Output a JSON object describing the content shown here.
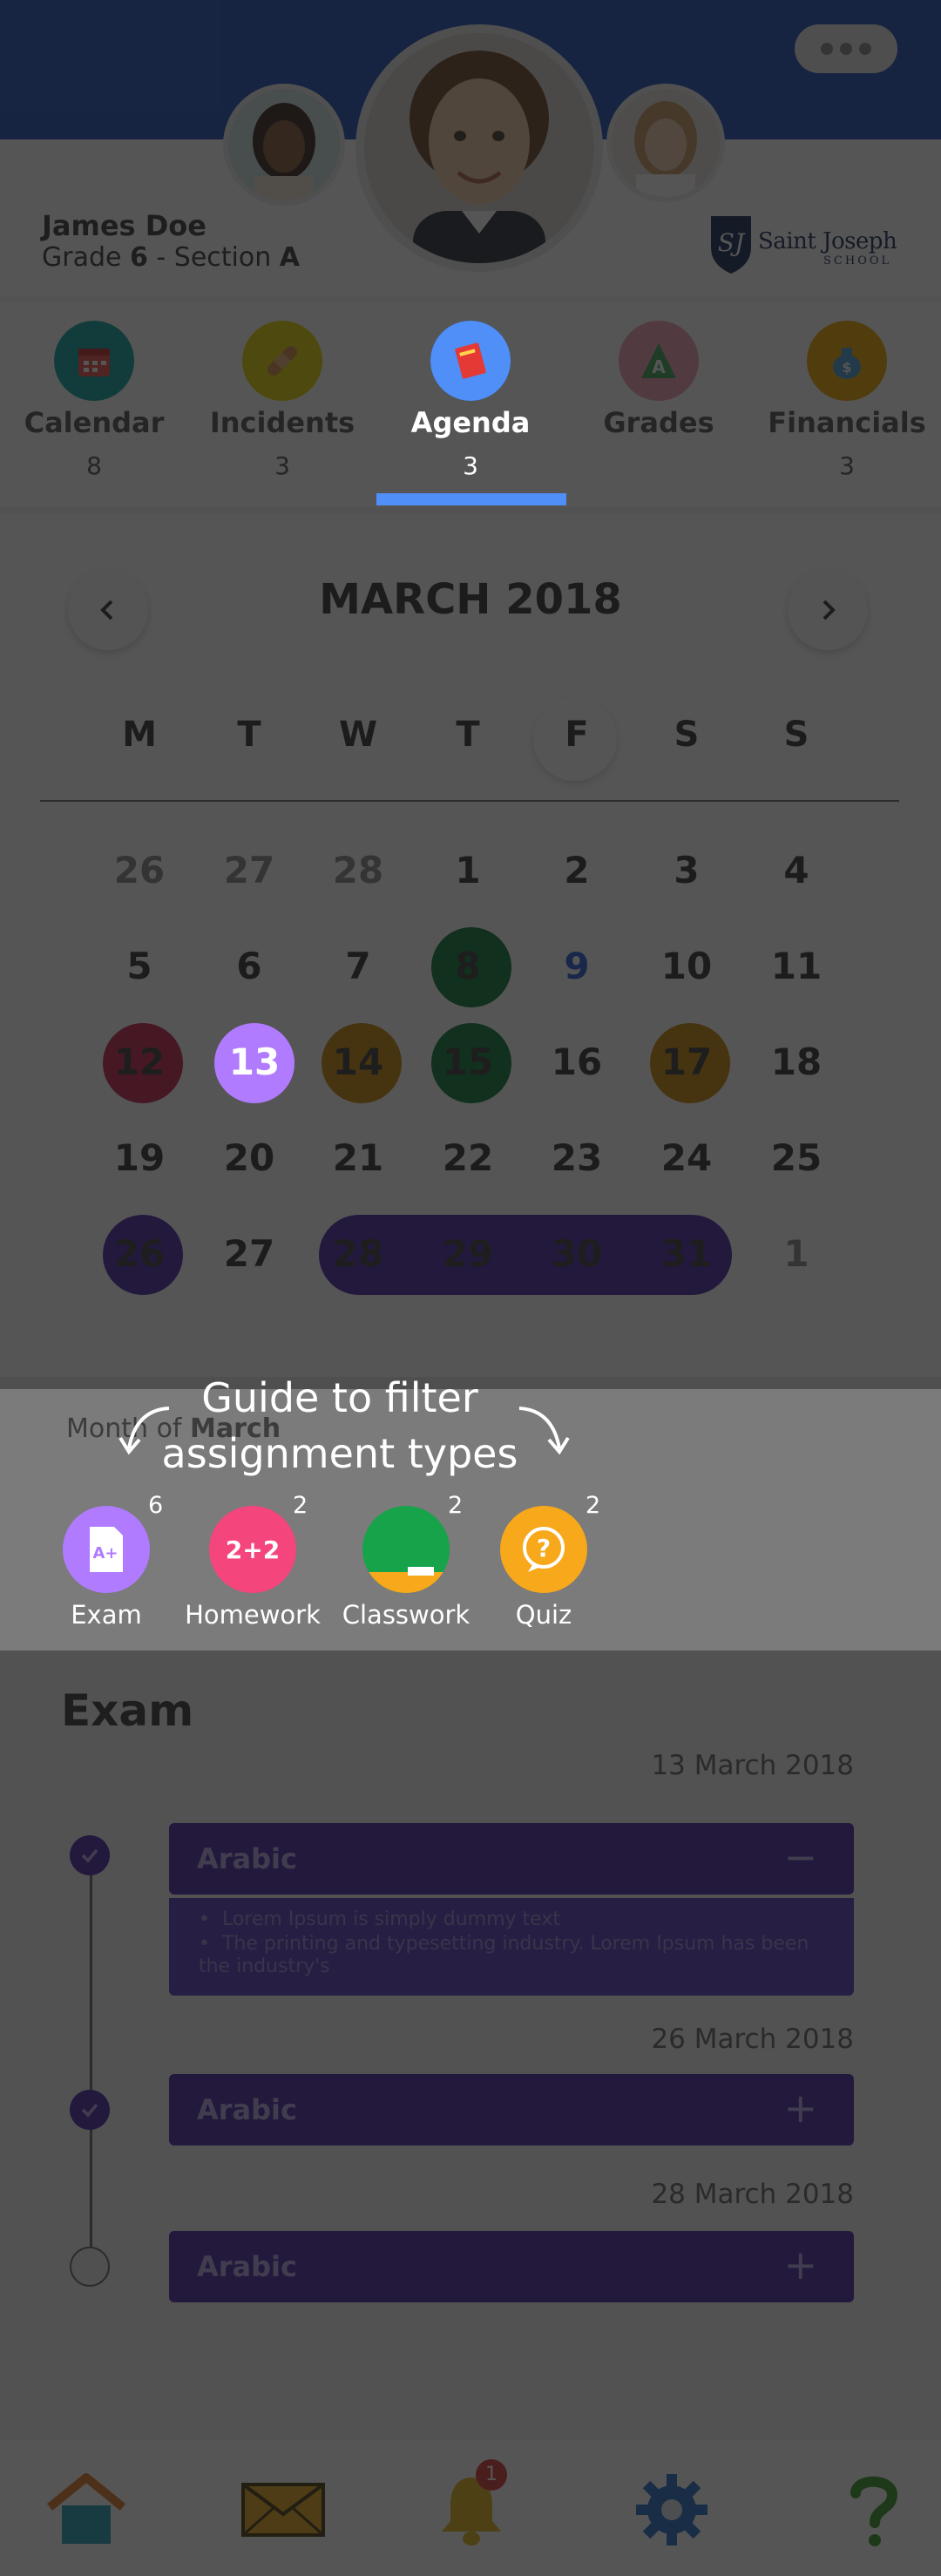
{
  "header": {
    "more_menu": "more-options",
    "student_name": "James Doe",
    "grade_prefix": "Grade ",
    "grade_num": "6",
    "section_prefix": " - Section ",
    "section_letter": "A",
    "school_name": "Saint Joseph",
    "school_sub": "SCHOOL"
  },
  "tabs": [
    {
      "label": "Calendar",
      "count": "8",
      "icon": "calendar-icon",
      "color": "#11a7a0"
    },
    {
      "label": "Incidents",
      "count": "3",
      "icon": "bandage-icon",
      "color": "#e5d400"
    },
    {
      "label": "Agenda",
      "count": "3",
      "icon": "book-icon",
      "color": "#4f8ff7",
      "active": true
    },
    {
      "label": "Grades",
      "count": "",
      "icon": "grade-a-icon",
      "color": "#f2a0b5"
    },
    {
      "label": "Financials",
      "count": "3",
      "icon": "money-bag-icon",
      "color": "#f0a500"
    }
  ],
  "calendar": {
    "month_title": "MARCH 2018",
    "weekdays": [
      "M",
      "T",
      "W",
      "T",
      "F",
      "S",
      "S"
    ],
    "week1": [
      "26",
      "27",
      "28",
      "1",
      "2",
      "3",
      "4"
    ],
    "week2": [
      "5",
      "6",
      "7",
      "8",
      "9",
      "10",
      "11"
    ],
    "week3": [
      "12",
      "13",
      "14",
      "15",
      "16",
      "17",
      "18"
    ],
    "week4": [
      "19",
      "20",
      "21",
      "22",
      "23",
      "24",
      "25"
    ],
    "week5": [
      "26",
      "27",
      "28",
      "29",
      "30",
      "31",
      "1"
    ]
  },
  "legend": {
    "month_prefix": "Month of ",
    "month_name": "March",
    "guide_line1": "Guide to filter",
    "guide_line2": "assignment types",
    "items": [
      {
        "label": "Exam",
        "count": "6",
        "color": "#b07bff"
      },
      {
        "label": "Homework",
        "count": "2",
        "color": "#f4457d"
      },
      {
        "label": "Classwork",
        "count": "2",
        "color": "#17a34a"
      },
      {
        "label": "Quiz",
        "count": "2",
        "color": "#f7a81b"
      }
    ]
  },
  "exam": {
    "heading": "Exam",
    "entries": [
      {
        "date": "13 March 2018",
        "subject": "Arabic",
        "toggle": "−",
        "expanded": true,
        "bullets": [
          "Lorem Ipsum is simply dummy text",
          "The printing and typesetting industry. Lorem Ipsum has been the industry's"
        ]
      },
      {
        "date": "26 March 2018",
        "subject": "Arabic",
        "toggle": "+"
      },
      {
        "date": "28 March 2018",
        "subject": "Arabic",
        "toggle": "+"
      }
    ]
  },
  "bottom_nav": {
    "items": [
      "home-icon",
      "mail-icon",
      "bell-icon",
      "settings-icon",
      "help-icon"
    ],
    "notification_count": "1"
  },
  "colors": {
    "header_blue": "#1f4fb8",
    "accent_purple": "#4b2aa9",
    "active_tab": "#4f8ff7"
  }
}
